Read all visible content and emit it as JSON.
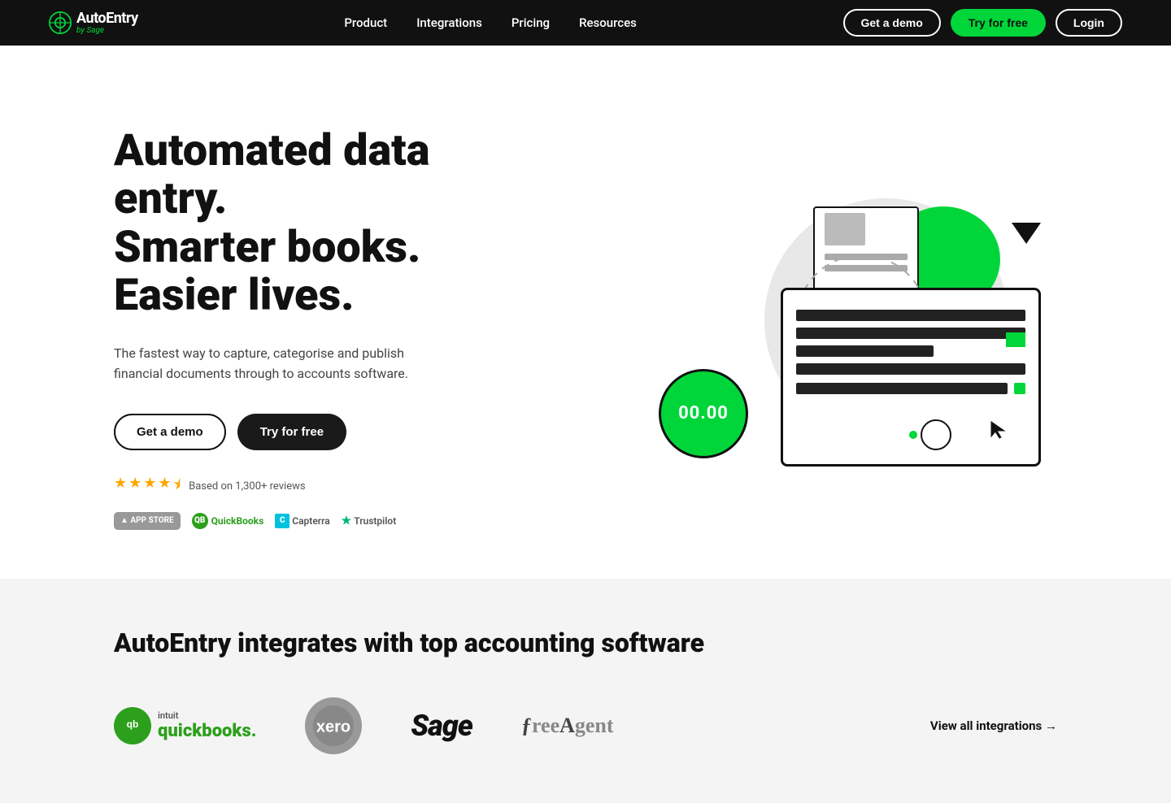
{
  "navbar": {
    "logo": {
      "brand": "AutoEntry",
      "sub": "by Sage"
    },
    "nav": {
      "product": "Product",
      "integrations": "Integrations",
      "pricing": "Pricing",
      "resources": "Resources"
    },
    "actions": {
      "demo": "Get a demo",
      "try_free": "Try for free",
      "login": "Login"
    }
  },
  "hero": {
    "title_line1": "Automated data entry.",
    "title_line2": "Smarter books.",
    "title_line3": "Easier lives.",
    "subtitle": "The fastest way to capture, categorise and publish financial documents through to accounts software.",
    "btn_demo": "Get a demo",
    "btn_try": "Try for free",
    "reviews_text": "Based on 1,300+ reviews",
    "illustration": {
      "amount": "00.00"
    }
  },
  "review_logos": [
    {
      "name": "App Store",
      "symbol": "A"
    },
    {
      "name": "QuickBooks",
      "symbol": "QB"
    },
    {
      "name": "Capterra",
      "symbol": "C"
    },
    {
      "name": "Trustpilot",
      "symbol": "★"
    }
  ],
  "integrations": {
    "title": "AutoEntry integrates with top accounting software",
    "logos": [
      {
        "name": "QuickBooks",
        "type": "quickbooks"
      },
      {
        "name": "Xero",
        "type": "xero"
      },
      {
        "name": "Sage",
        "type": "sage"
      },
      {
        "name": "FreeAgent",
        "type": "freeagent"
      }
    ],
    "view_all": "View all integrations →"
  }
}
